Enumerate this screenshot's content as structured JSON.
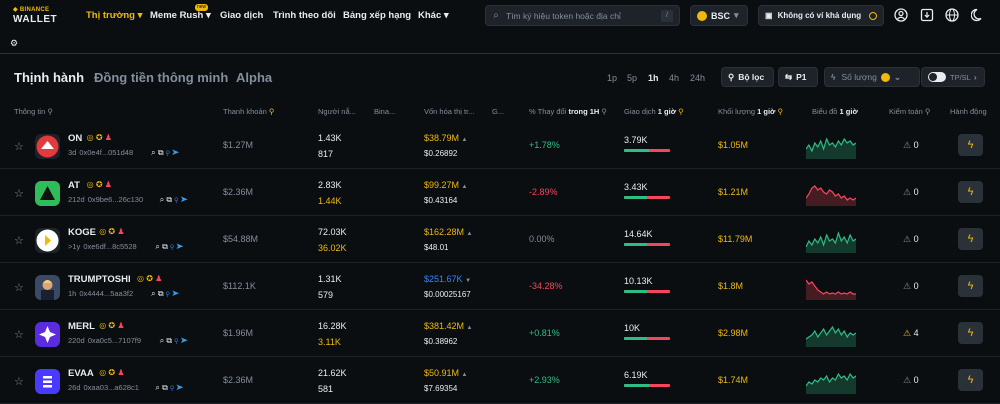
{
  "topbar": {
    "logo_line1": "◆ BINANCE",
    "logo_line2": "WALLET",
    "nav": [
      "Thị trường ▾",
      "Meme Rush ▾",
      "Giao dịch",
      "Trình theo dõi",
      "Bảng xếp hạng",
      "Khác ▾"
    ],
    "new_badge": "new",
    "search_placeholder": "Tìm ký hiệu token hoặc địa chỉ",
    "search_shortcut": "/",
    "chain": "BSC",
    "wallet": "Không có ví khả dụng"
  },
  "tabs": [
    "Thịnh hành",
    "Đồng tiền thông minh",
    "Alpha"
  ],
  "timeframes": [
    "1p",
    "5p",
    "1h",
    "4h",
    "24h"
  ],
  "active_timeframe": "1h",
  "buttons": {
    "filter": "Bộ lọc",
    "preset": "P1",
    "quantity": "Số lượng",
    "tpsl": "TP/SL"
  },
  "headers": {
    "info": "Thông tin",
    "liquidity": "Thanh khoản",
    "holders": "Người nắ...",
    "binance": "Bina...",
    "mcap": "Vốn hóa thị tr...",
    "g": "G...",
    "change_prefix": "% Thay đổi",
    "change_bold": "trong 1H",
    "tx_prefix": "Giao dịch",
    "tx_bold": "1 giờ",
    "vol_prefix": "Khối lượng",
    "vol_bold": "1 giờ",
    "chart_prefix": "Biểu đồ",
    "chart_bold": "1 giờ",
    "audit": "Kiểm toán",
    "action": "Hành động"
  },
  "rows": [
    {
      "name": "ON",
      "age": "3d",
      "addr": "0x0e4f...051d48",
      "liq": "$1.27M",
      "holders": "1.43K",
      "binance": "817",
      "binance_yellow": false,
      "mcap": "$38.79M",
      "mcap_arrow": "▲",
      "price": "$0.26892",
      "change": "+1.78%",
      "dir": "up",
      "tx": "3.79K",
      "tx_buy": 0.55,
      "vol": "$1.05M",
      "audit": "0",
      "audit_warn": false,
      "spark_color": "#2ebd85",
      "spark": [
        0.4,
        0.6,
        0.3,
        0.7,
        0.5,
        0.8,
        0.4,
        0.9,
        0.6,
        0.7,
        0.5,
        0.8,
        0.6,
        0.9,
        0.7,
        0.8,
        0.6,
        0.7
      ]
    },
    {
      "name": "AT",
      "age": "212d",
      "addr": "0x9be6...26c130",
      "liq": "$2.36M",
      "holders": "2.83K",
      "binance": "1.44K",
      "binance_yellow": true,
      "mcap": "$99.27M",
      "mcap_arrow": "▲",
      "price": "$0.43164",
      "change": "-2.89%",
      "dir": "down",
      "tx": "3.43K",
      "tx_buy": 0.5,
      "vol": "$1.21M",
      "audit": "0",
      "audit_warn": false,
      "spark_color": "#f6465d",
      "spark": [
        0.3,
        0.5,
        0.8,
        0.9,
        0.7,
        0.8,
        0.6,
        0.5,
        0.7,
        0.6,
        0.4,
        0.5,
        0.3,
        0.4,
        0.2,
        0.3,
        0.2,
        0.3
      ]
    },
    {
      "name": "KOGE",
      "age": ">1y",
      "addr": "0xe6df...8c5528",
      "liq": "$54.88M",
      "holders": "72.03K",
      "binance": "36.02K",
      "binance_yellow": true,
      "mcap": "$162.28M",
      "mcap_arrow": "▲",
      "price": "$48.01",
      "change": "0.00%",
      "dir": "flat",
      "tx": "14.64K",
      "tx_buy": 0.5,
      "vol": "$11.79M",
      "audit": "0",
      "audit_warn": false,
      "spark_color": "#2ebd85",
      "spark": [
        0.2,
        0.5,
        0.3,
        0.6,
        0.4,
        0.7,
        0.3,
        0.8,
        0.5,
        0.6,
        0.4,
        0.9,
        0.5,
        0.7,
        0.4,
        0.8,
        0.5,
        0.6
      ]
    },
    {
      "name": "TRUMPTOSHI",
      "age": "1h",
      "addr": "0x4444...5aa3f2",
      "liq": "$112.1K",
      "holders": "1.31K",
      "binance": "579",
      "binance_yellow": false,
      "mcap": "$251.67K",
      "mcap_arrow": "▼",
      "mcap_blue": true,
      "price": "$0.00025167",
      "change": "-34.28%",
      "dir": "down",
      "tx": "10.13K",
      "tx_buy": 0.5,
      "vol": "$1.8M",
      "audit": "0",
      "audit_warn": false,
      "spark_color": "#f6465d",
      "spark": [
        0.9,
        0.7,
        0.8,
        0.6,
        0.4,
        0.3,
        0.2,
        0.3,
        0.2,
        0.25,
        0.2,
        0.3,
        0.2,
        0.25,
        0.2,
        0.3,
        0.2,
        0.2
      ]
    },
    {
      "name": "MERL",
      "age": "220d",
      "addr": "0xa0c5...7107f9",
      "liq": "$1.96M",
      "holders": "16.28K",
      "binance": "3.11K",
      "binance_yellow": true,
      "mcap": "$381.42M",
      "mcap_arrow": "▲",
      "price": "$0.38962",
      "change": "+0.81%",
      "dir": "up",
      "tx": "10K",
      "tx_buy": 0.5,
      "vol": "$2.98M",
      "audit": "4",
      "audit_warn": true,
      "spark_color": "#2ebd85",
      "spark": [
        0.3,
        0.4,
        0.5,
        0.7,
        0.4,
        0.6,
        0.8,
        0.5,
        0.7,
        0.9,
        0.6,
        0.8,
        0.5,
        0.7,
        0.4,
        0.6,
        0.5,
        0.6
      ]
    },
    {
      "name": "EVAA",
      "age": "26d",
      "addr": "0xaa03...a628c1",
      "liq": "$2.36M",
      "holders": "21.62K",
      "binance": "581",
      "binance_yellow": false,
      "mcap": "$50.91M",
      "mcap_arrow": "▲",
      "price": "$7.69354",
      "change": "+2.93%",
      "dir": "up",
      "tx": "6.19K",
      "tx_buy": 0.55,
      "vol": "$1.74M",
      "audit": "0",
      "audit_warn": false,
      "spark_color": "#2ebd85",
      "spark": [
        0.3,
        0.5,
        0.4,
        0.6,
        0.5,
        0.7,
        0.6,
        0.8,
        0.5,
        0.7,
        0.6,
        0.9,
        0.7,
        0.8,
        0.6,
        0.9,
        0.7,
        0.8
      ]
    }
  ]
}
